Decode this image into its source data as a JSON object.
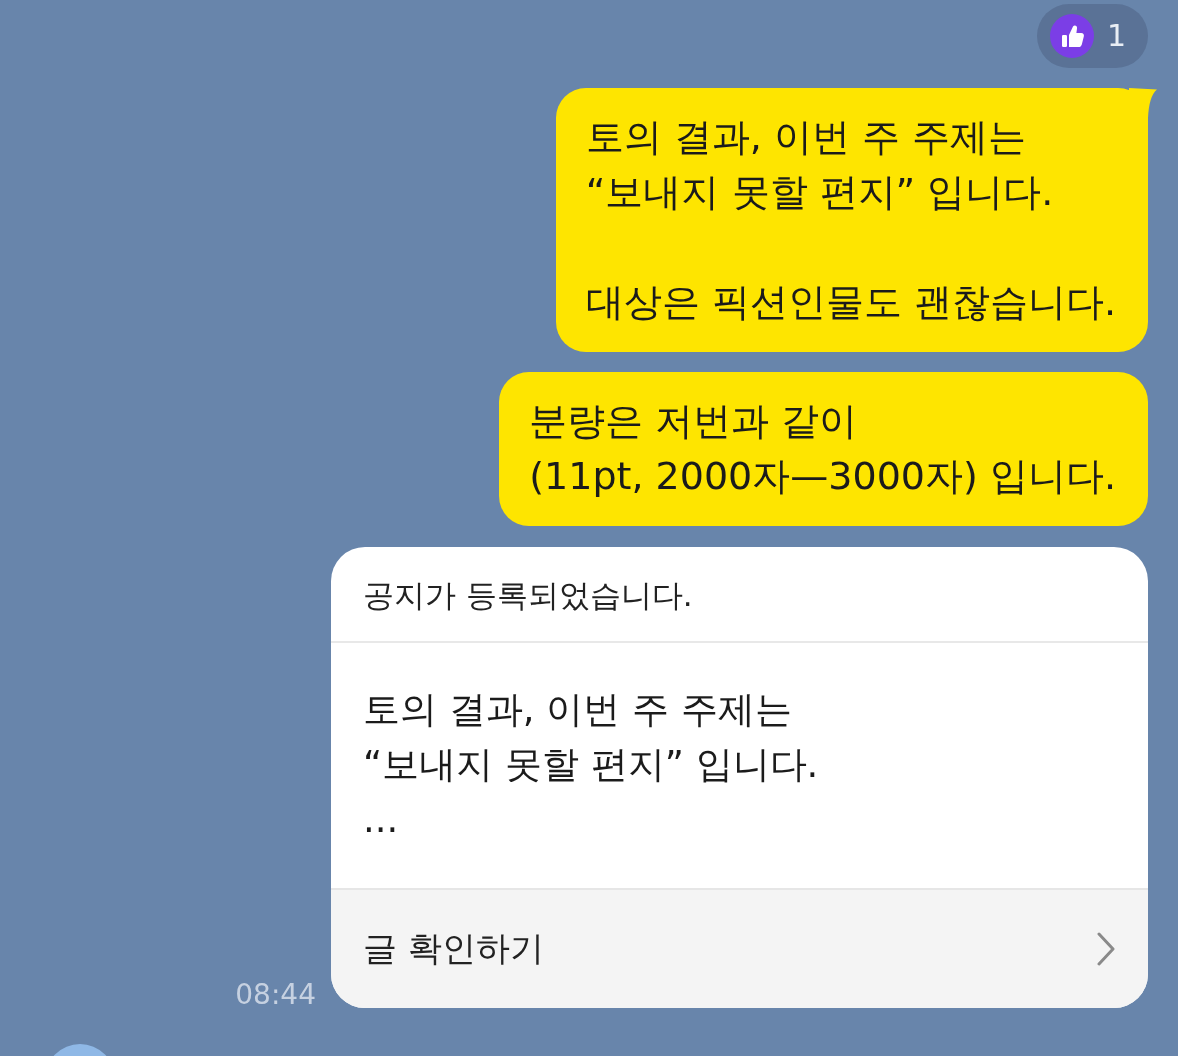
{
  "reaction": {
    "count": "1"
  },
  "messages": [
    {
      "kind": "text",
      "tail": true,
      "text": "토의 결과, 이번 주 주제는\n“보내지 못할 편지” 입니다.\n\n대상은 픽션인물도 괜찮습니다."
    },
    {
      "kind": "text",
      "tail": false,
      "text": "분량은 저번과 같이\n(11pt, 2000자—3000자) 입니다."
    },
    {
      "kind": "notice",
      "title": "공지가 등록되었습니다.",
      "body": "토의 결과, 이번 주 주제는\n“보내지 못할 편지” 입니다.\n...",
      "action": "글 확인하기",
      "time": "08:44"
    }
  ]
}
